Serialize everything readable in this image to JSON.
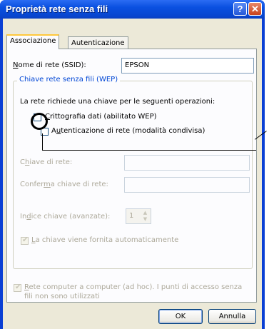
{
  "window": {
    "title": "Proprietà rete senza fili",
    "help_glyph": "?",
    "close_glyph": "✕"
  },
  "tabs": [
    {
      "label": "Associazione",
      "active": true
    },
    {
      "label": "Autenticazione",
      "active": false
    }
  ],
  "ssid": {
    "label_prefix": "N",
    "label_rest": "ome di rete (SSID):",
    "value": "EPSON"
  },
  "wep_group": {
    "title": "Chiave rete senza fili (WEP)",
    "intro": "La rete richiede una chiave per le seguenti operazioni:",
    "encryption": {
      "prefix": "",
      "accel": "C",
      "rest": "rittografia dati (abilitato WEP)",
      "checked": false
    },
    "auth": {
      "prefix": "A",
      "accel": "u",
      "rest": "tenticazione di rete (modalità condivisa)",
      "checked": false
    },
    "network_key": {
      "prefix": "C",
      "accel": "h",
      "rest": "iave di rete:",
      "value": ""
    },
    "confirm_key": {
      "prefix": "Confer",
      "accel": "m",
      "rest": "a chiave di rete:",
      "value": ""
    },
    "key_index": {
      "prefix": "In",
      "accel": "d",
      "rest": "ice chiave (avanzate):",
      "value": "1"
    },
    "auto_key": {
      "accel": "L",
      "rest": "a chiave viene fornita automaticamente",
      "checked": true
    }
  },
  "adhoc": {
    "accel": "R",
    "line1_rest": "ete computer a computer (ad hoc). I punti di accesso senza",
    "line2": "fili non sono utilizzati",
    "checked": true
  },
  "buttons": {
    "ok": "OK",
    "cancel": "Annulla"
  },
  "colors": {
    "titlebar": "#0a50e0",
    "dialog_bg": "#ece9d8",
    "group_title": "#0046d5"
  }
}
